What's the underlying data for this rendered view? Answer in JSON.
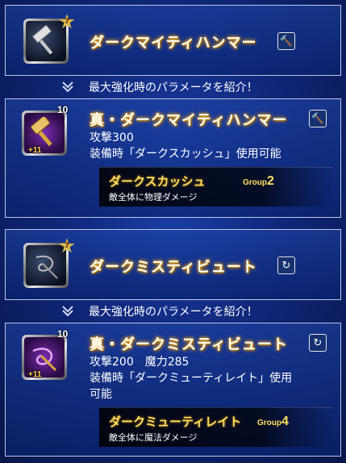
{
  "weapons": [
    {
      "name": "ダークマイティハンマー",
      "star_badge": "7",
      "type_icon": "hammer-icon",
      "reinforce_note": "最大強化時のパラメータを紹介！",
      "max": {
        "name": "真・ダークマイティハンマー",
        "level": "10",
        "plus": "+11",
        "stats": "攻撃300",
        "effect": "装備時「ダークスカッシュ」使用可能",
        "ability": {
          "name": "ダークスカッシュ",
          "group_label": "Group",
          "group_num": "2",
          "desc": "敵全体に物理ダメージ"
        }
      }
    },
    {
      "name": "ダークミスティビュート",
      "star_badge": "7",
      "type_icon": "whip-icon",
      "reinforce_note": "最大強化時のパラメータを紹介！",
      "max": {
        "name": "真・ダークミスティビュート",
        "level": "10",
        "plus": "+11",
        "stats": "攻撃200　魔力285",
        "effect_line1": "装備時「ダークミューティレイト」使用",
        "effect_line2": "可能",
        "ability": {
          "name": "ダークミューティレイト",
          "group_label": "Group",
          "group_num": "4",
          "desc": "敵全体に魔法ダメージ"
        }
      }
    }
  ],
  "colors": {
    "title_glow": "#ffb800",
    "ability_text": "#ffe061",
    "panel_border": "#b9c6e6"
  }
}
